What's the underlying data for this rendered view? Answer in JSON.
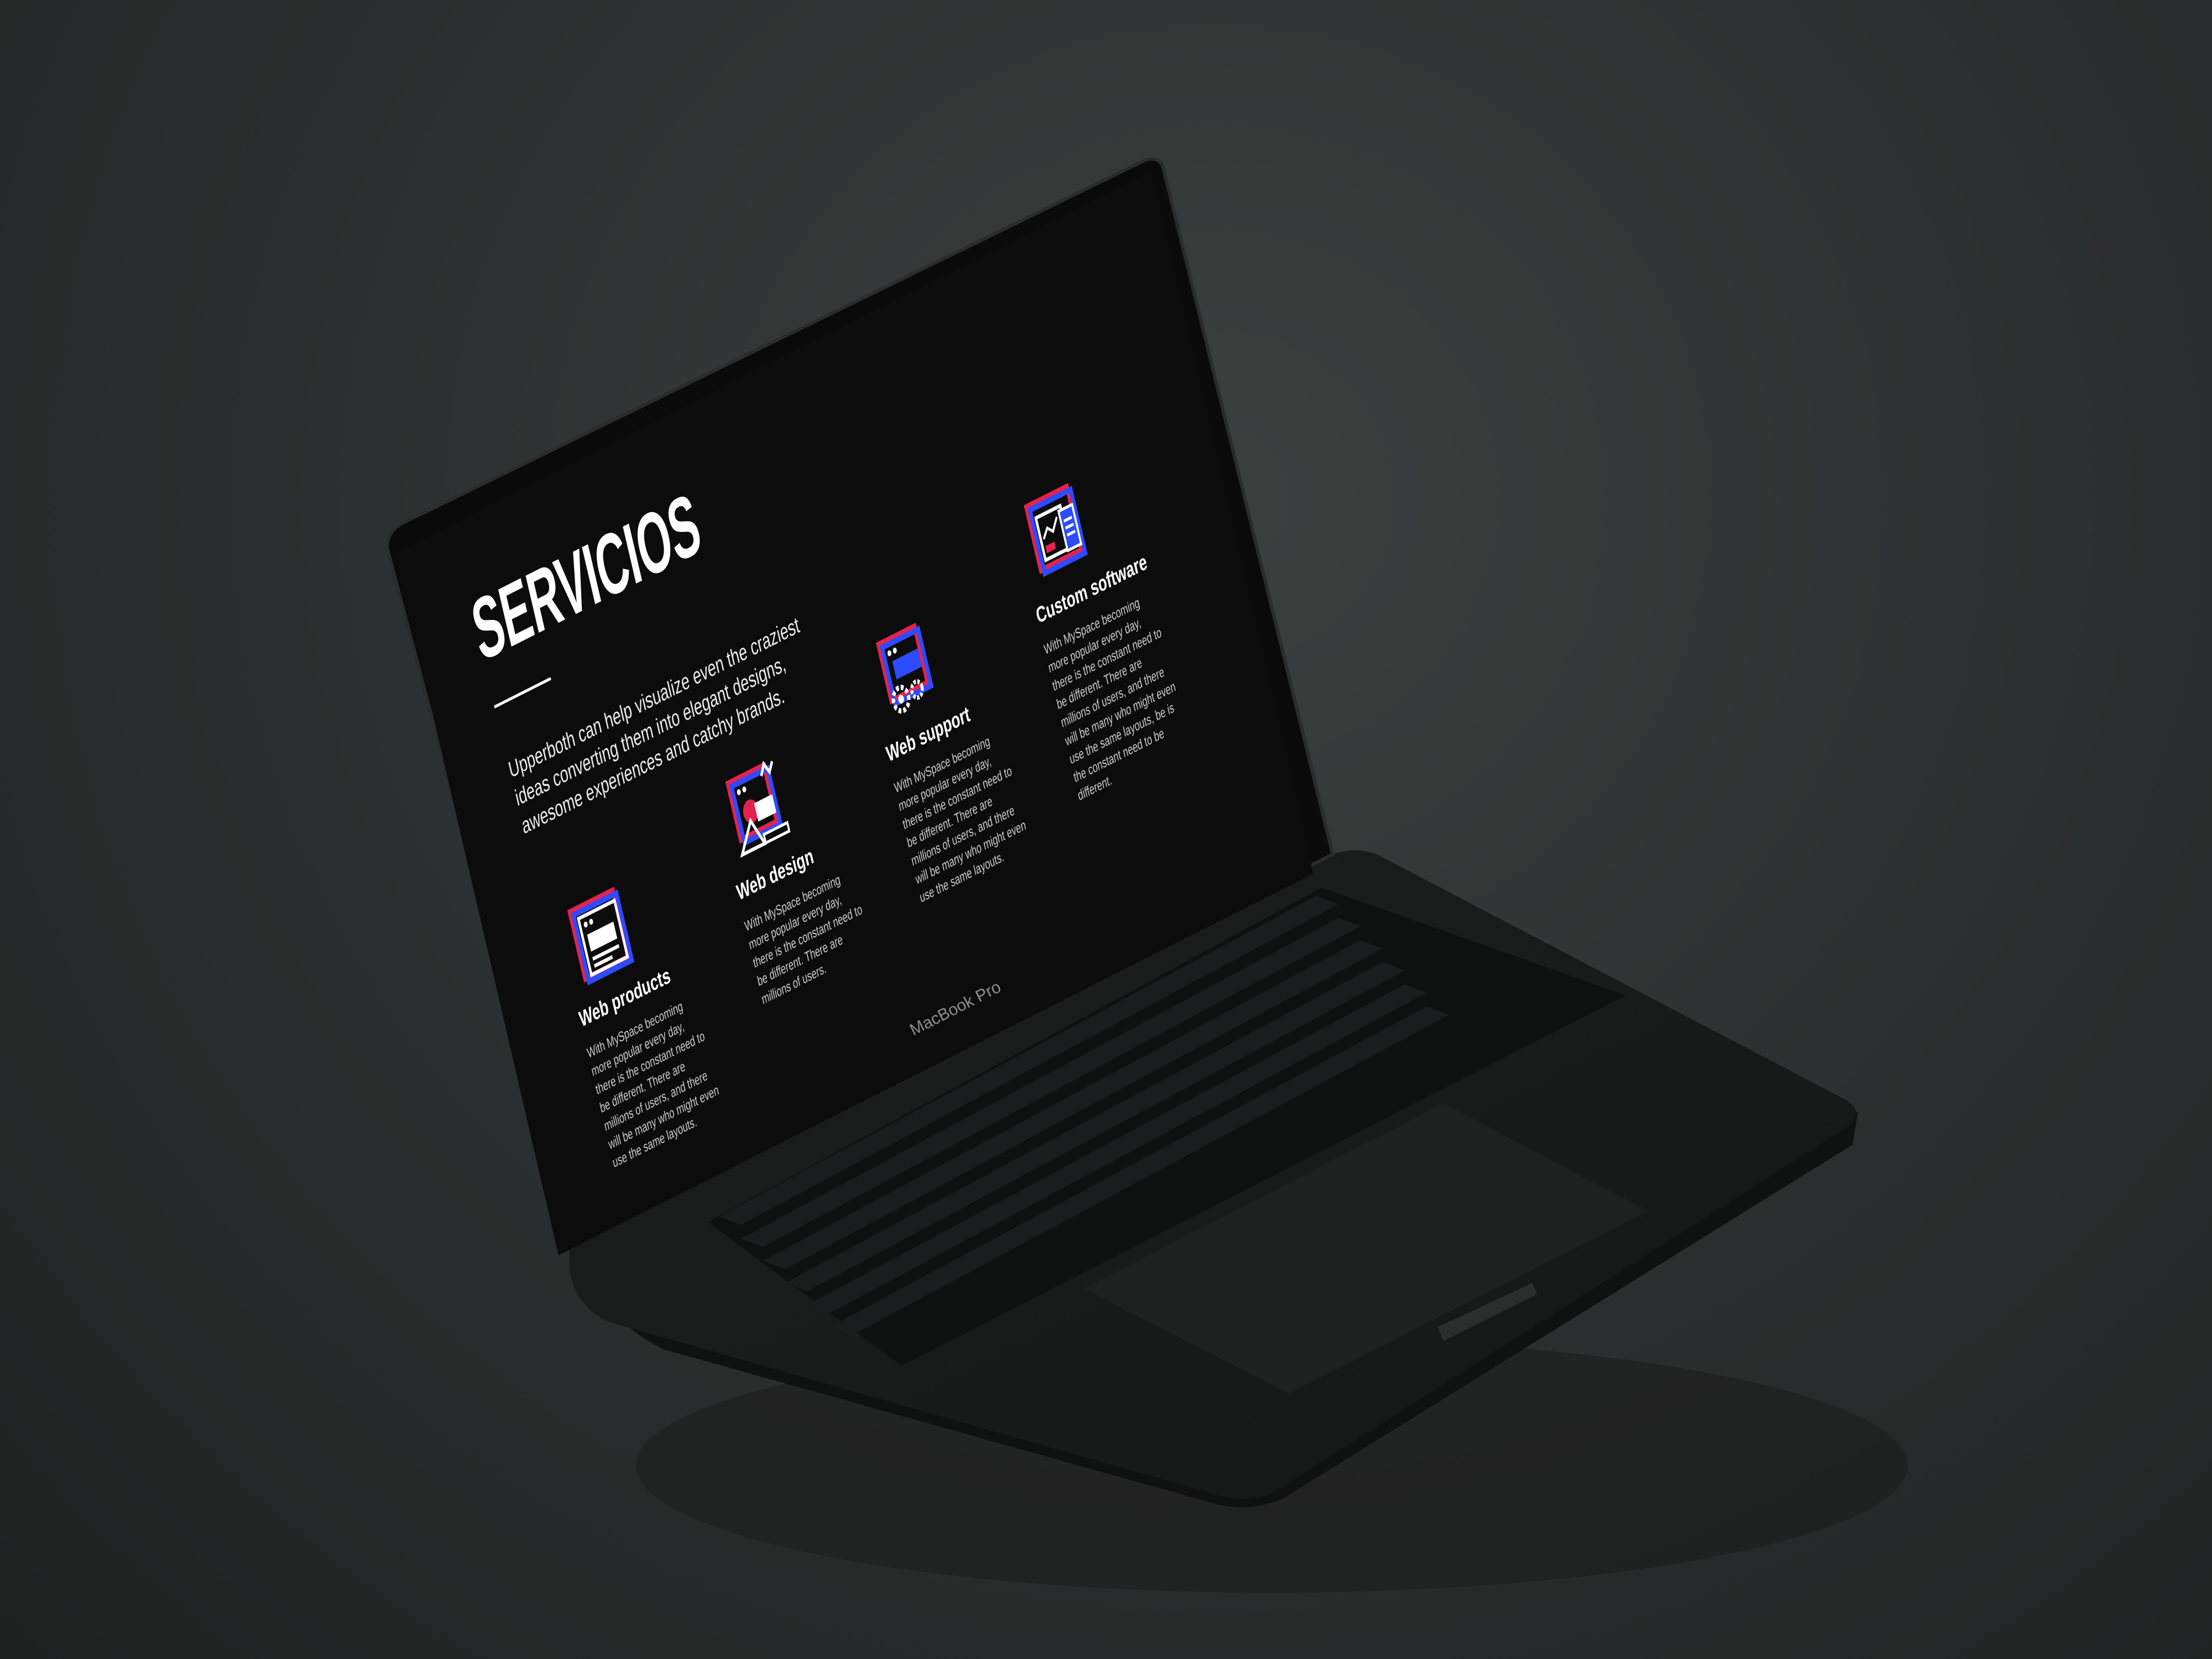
{
  "screen": {
    "title": "SERVICIOS",
    "intro": "Upperboth can help visualize even the craziest ideas converting them into elegant designs, awesome experiences and catchy brands.",
    "services": [
      {
        "title": "Web products",
        "icon": "web-products-icon",
        "text": "With MySpace becoming more popular every day, there is the constant need to be different. There are millions of users, and there will be many who might even use the same layouts."
      },
      {
        "title": "Web design",
        "icon": "web-design-icon",
        "text": "With MySpace becoming more popular every day, there is the constant need to be different. There are millions of users."
      },
      {
        "title": "Web support",
        "icon": "web-support-icon",
        "text": "With MySpace becoming more popular every day, there is the constant need to be different. There are millions of users, and there will be many who might even use the same layouts."
      },
      {
        "title": "Custom software",
        "icon": "custom-software-icon",
        "text": "With MySpace becoming more popular every day, there is the constant need to be different. There are millions of users, and there will be many who might even use the same layouts, be is the constant need to be different."
      }
    ],
    "colors": {
      "accent_red": "#e5224f",
      "accent_blue": "#2d4bff",
      "background": "#0c0c0c"
    }
  },
  "device": {
    "label": "MacBook Pro"
  }
}
